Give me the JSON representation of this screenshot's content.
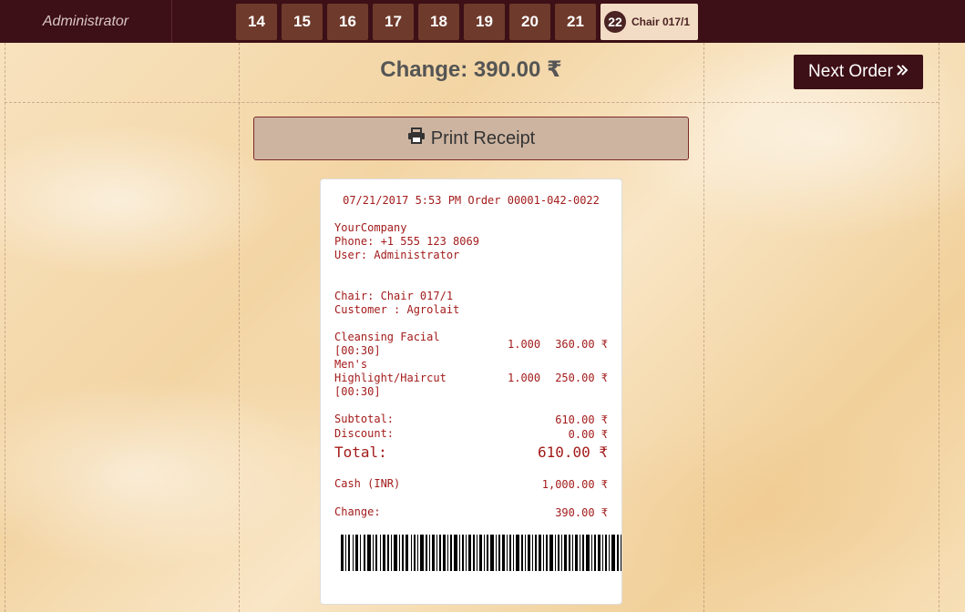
{
  "topbar": {
    "user": "Administrator",
    "orders": [
      "14",
      "15",
      "16",
      "17",
      "18",
      "19",
      "20",
      "21"
    ],
    "active_order": {
      "number": "22",
      "label": "Chair 017/1"
    }
  },
  "summary": {
    "change": "Change: 390.00 ₹",
    "next_order": "Next Order",
    "print_receipt": "Print Receipt"
  },
  "receipt": {
    "header": "07/21/2017 5:53 PM Order 00001-042-0022",
    "company": "YourCompany",
    "phone": "Phone: +1 555 123 8069",
    "user": "User: Administrator",
    "chair": "Chair: Chair 017/1",
    "customer": "Customer : Agrolait",
    "lines": [
      {
        "name1": "Cleansing Facial",
        "name2": "[00:30]",
        "name3": "",
        "qty": "1.000",
        "price": "360.00 ₹"
      },
      {
        "name1": "Men's",
        "name2": "Highlight/Haircut",
        "name3": "[00:30]",
        "qty": "1.000",
        "price": "250.00 ₹"
      }
    ],
    "subtotal_label": "Subtotal:",
    "subtotal": "610.00 ₹",
    "discount_label": "Discount:",
    "discount": "0.00 ₹",
    "total_label": "Total:",
    "total": "610.00 ₹",
    "payment_label": "Cash (INR)",
    "payment": "1,000.00 ₹",
    "change_label": "Change:",
    "change": "390.00 ₹"
  },
  "colors": {
    "topbar": "#3d0f16",
    "order_tab": "#6e3a2b",
    "active_tab": "#f3dcc5",
    "receipt_text": "#a31b1b",
    "print_button": "#cdb4a0"
  },
  "icons": {
    "print": "printer-icon",
    "next": "double-chevron-right-icon"
  }
}
